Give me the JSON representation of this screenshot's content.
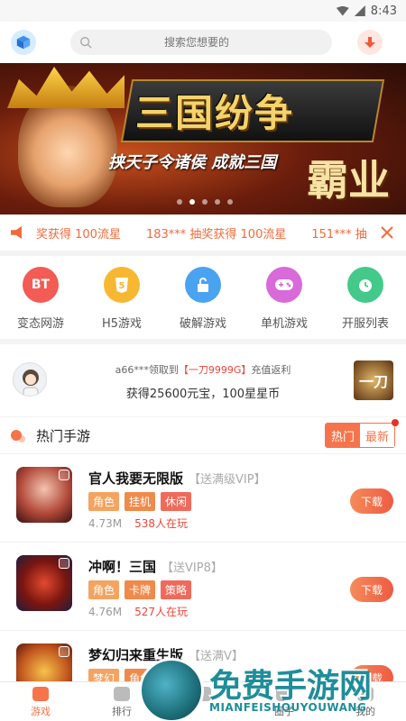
{
  "status_bar": {
    "time": "8:43"
  },
  "header": {
    "search_placeholder": "搜索您想要的"
  },
  "banner": {
    "title": "三国纷争",
    "slogan": "挟天子令诸侯  成就三国",
    "big_word": "霸业"
  },
  "notice": {
    "items": [
      "奖获得 100流星",
      "183*** 抽奖获得 100流星",
      "151*** 抽"
    ]
  },
  "categories": [
    {
      "label": "变态网游",
      "icon_text": "BT",
      "color": "#f25c54"
    },
    {
      "label": "H5游戏",
      "icon_text": "5",
      "color": "#f7b731"
    },
    {
      "label": "破解游戏",
      "icon_text": "",
      "color": "#4aa3f0"
    },
    {
      "label": "单机游戏",
      "icon_text": "",
      "color": "#d86ad9"
    },
    {
      "label": "开服列表",
      "icon_text": "",
      "color": "#43c98a"
    }
  ],
  "reward": {
    "user": "a66***领取到",
    "item": "【一刀9999G】",
    "suffix": "充值返利",
    "detail": "获得25600元宝，100星星币",
    "thumb_text": "一刀"
  },
  "hot": {
    "title": "热门手游",
    "tab_hot": "热门",
    "tab_new": "最新"
  },
  "games": [
    {
      "name": "官人我要无限版",
      "gift": "【送满级VIP】",
      "tags": [
        "角色",
        "挂机",
        "休闲"
      ],
      "size": "4.73M",
      "players": "538人在玩",
      "download": "下载"
    },
    {
      "name": "冲啊！三国",
      "gift": "【送VIP8】",
      "tags": [
        "角色",
        "卡牌",
        "策略"
      ],
      "size": "4.76M",
      "players": "527人在玩",
      "download": "下载"
    },
    {
      "name": "梦幻归来重生版",
      "gift": "【送满V】",
      "tags": [
        "梦幻",
        "角色"
      ],
      "size": "",
      "players": "",
      "download": "下载"
    }
  ],
  "tag_colors": {
    "角色": "#f4a460",
    "挂机": "#f08a4b",
    "休闲": "#ef6a5b",
    "卡牌": "#f08a4b",
    "策略": "#ef6a5b",
    "梦幻": "#f4a460"
  },
  "tabbar": {
    "tabs": [
      "游戏",
      "排行",
      "",
      "圈子",
      "我的"
    ]
  },
  "watermark": {
    "cn": "免费手游网",
    "en": "MIANFEISHOUYOUWANG"
  }
}
